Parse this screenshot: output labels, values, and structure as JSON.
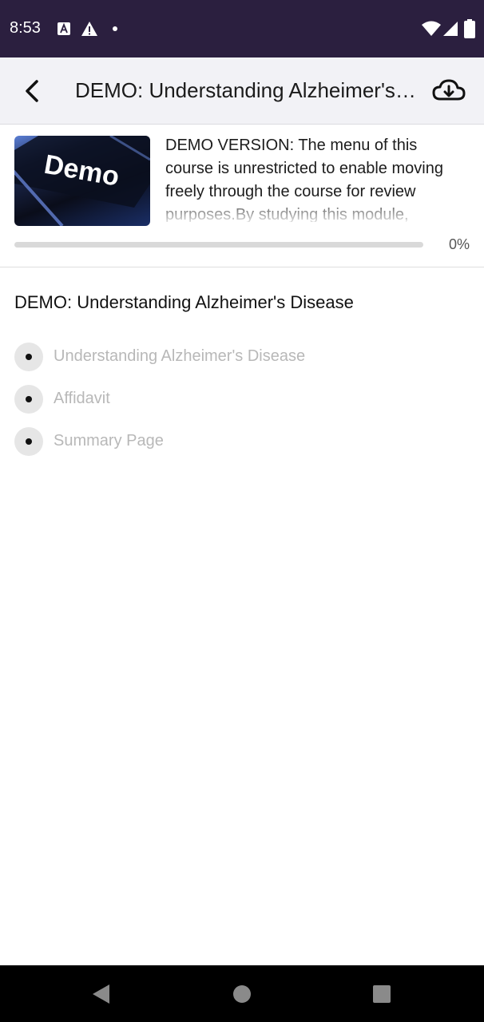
{
  "status_bar": {
    "time": "8:53",
    "icons": [
      "font-a-icon",
      "warning-icon",
      "dot-icon",
      "wifi-icon",
      "signal-icon",
      "battery-icon"
    ]
  },
  "app_bar": {
    "title": "DEMO: Understanding Alzheimer's Disease",
    "icons": {
      "back": "back-arrow-icon",
      "download": "cloud-download-icon"
    }
  },
  "course": {
    "thumbnail_text": "Demo",
    "description": "DEMO VERSION: The menu of this course is unrestricted to enable moving freely through the course for review purposes.By studying this module,",
    "progress_percent": 0,
    "progress_label": "0%"
  },
  "section": {
    "title": "DEMO: Understanding Alzheimer's Disease",
    "lessons": [
      {
        "label": "Understanding Alzheimer's Disease"
      },
      {
        "label": "Affidavit"
      },
      {
        "label": "Summary Page"
      }
    ]
  },
  "nav_bar": {
    "icons": [
      "back-triangle-icon",
      "home-circle-icon",
      "recents-square-icon"
    ]
  },
  "colors": {
    "status_bar_bg": "#2b1f3f",
    "app_bar_bg": "#f2f2f6",
    "progress_track": "#d9d9d9",
    "lesson_text": "#b8b8b8"
  }
}
